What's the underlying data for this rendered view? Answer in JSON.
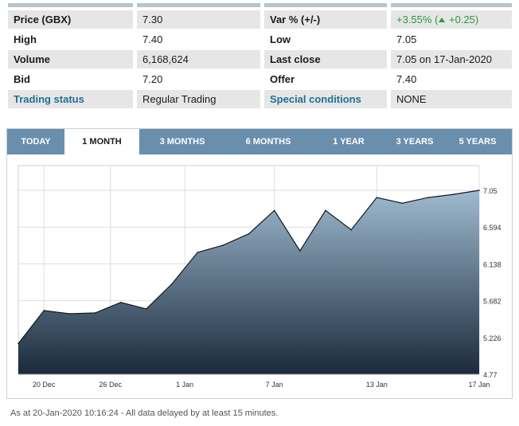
{
  "quote": {
    "rows": [
      [
        {
          "text": "Price (GBX)",
          "style": "label"
        },
        {
          "text": "7.30"
        },
        {
          "text": "Var % (+/-)",
          "style": "label"
        },
        {
          "text": "",
          "style": "var"
        }
      ],
      [
        {
          "text": "High",
          "style": "label"
        },
        {
          "text": "7.40"
        },
        {
          "text": "Low",
          "style": "label"
        },
        {
          "text": "7.05"
        }
      ],
      [
        {
          "text": "Volume",
          "style": "label"
        },
        {
          "text": "6,168,624"
        },
        {
          "text": "Last close",
          "style": "label"
        },
        {
          "text": "7.05 on 17-Jan-2020"
        }
      ],
      [
        {
          "text": "Bid",
          "style": "label"
        },
        {
          "text": "7.20"
        },
        {
          "text": "Offer",
          "style": "label"
        },
        {
          "text": "7.40"
        }
      ],
      [
        {
          "text": "Trading status",
          "style": "link"
        },
        {
          "text": "Regular Trading"
        },
        {
          "text": "Special conditions",
          "style": "link"
        },
        {
          "text": "NONE"
        }
      ]
    ],
    "var_change": {
      "percent": "+3.55%",
      "open_paren": "(",
      "abs": "+0.25",
      "close_paren": ")",
      "color": "#2a9b3a"
    }
  },
  "tabs": [
    {
      "label": "TODAY",
      "active": false
    },
    {
      "label": "1 MONTH",
      "active": true
    },
    {
      "label": "3 MONTHS",
      "active": false
    },
    {
      "label": "6 MONTHS",
      "active": false
    },
    {
      "label": "1 YEAR",
      "active": false
    },
    {
      "label": "3 YEARS",
      "active": false
    },
    {
      "label": "5 YEARS",
      "active": false
    }
  ],
  "chart_data": {
    "type": "area",
    "x_ticks": [
      "20 Dec",
      "26 Dec",
      "1 Jan",
      "7 Jan",
      "13 Jan",
      "17 Jan"
    ],
    "y_ticks": [
      "7.05",
      "6.594",
      "6.138",
      "5.682",
      "5.226",
      "4.77"
    ],
    "ylim": [
      4.77,
      7.05
    ],
    "grid": true,
    "x": [
      "19 Dec",
      "20 Dec",
      "23 Dec",
      "24 Dec",
      "27 Dec",
      "30 Dec",
      "31 Dec",
      "2 Jan",
      "3 Jan",
      "6 Jan",
      "7 Jan",
      "8 Jan",
      "9 Jan",
      "10 Jan",
      "13 Jan",
      "14 Jan",
      "15 Jan",
      "16 Jan",
      "17 Jan"
    ],
    "values": [
      5.15,
      5.56,
      5.52,
      5.53,
      5.66,
      5.58,
      5.89,
      6.28,
      6.37,
      6.51,
      6.8,
      6.3,
      6.8,
      6.56,
      6.96,
      6.89,
      6.96,
      7.0,
      7.05
    ],
    "colors": {
      "fill_top": "#9fbacf",
      "fill_bottom": "#1b2a3c",
      "line": "#111a24",
      "grid": "#d9dee3",
      "text": "#333333"
    }
  },
  "footer": "As at 20-Jan-2020 10:16:24 -  All data delayed by at least 15 minutes."
}
